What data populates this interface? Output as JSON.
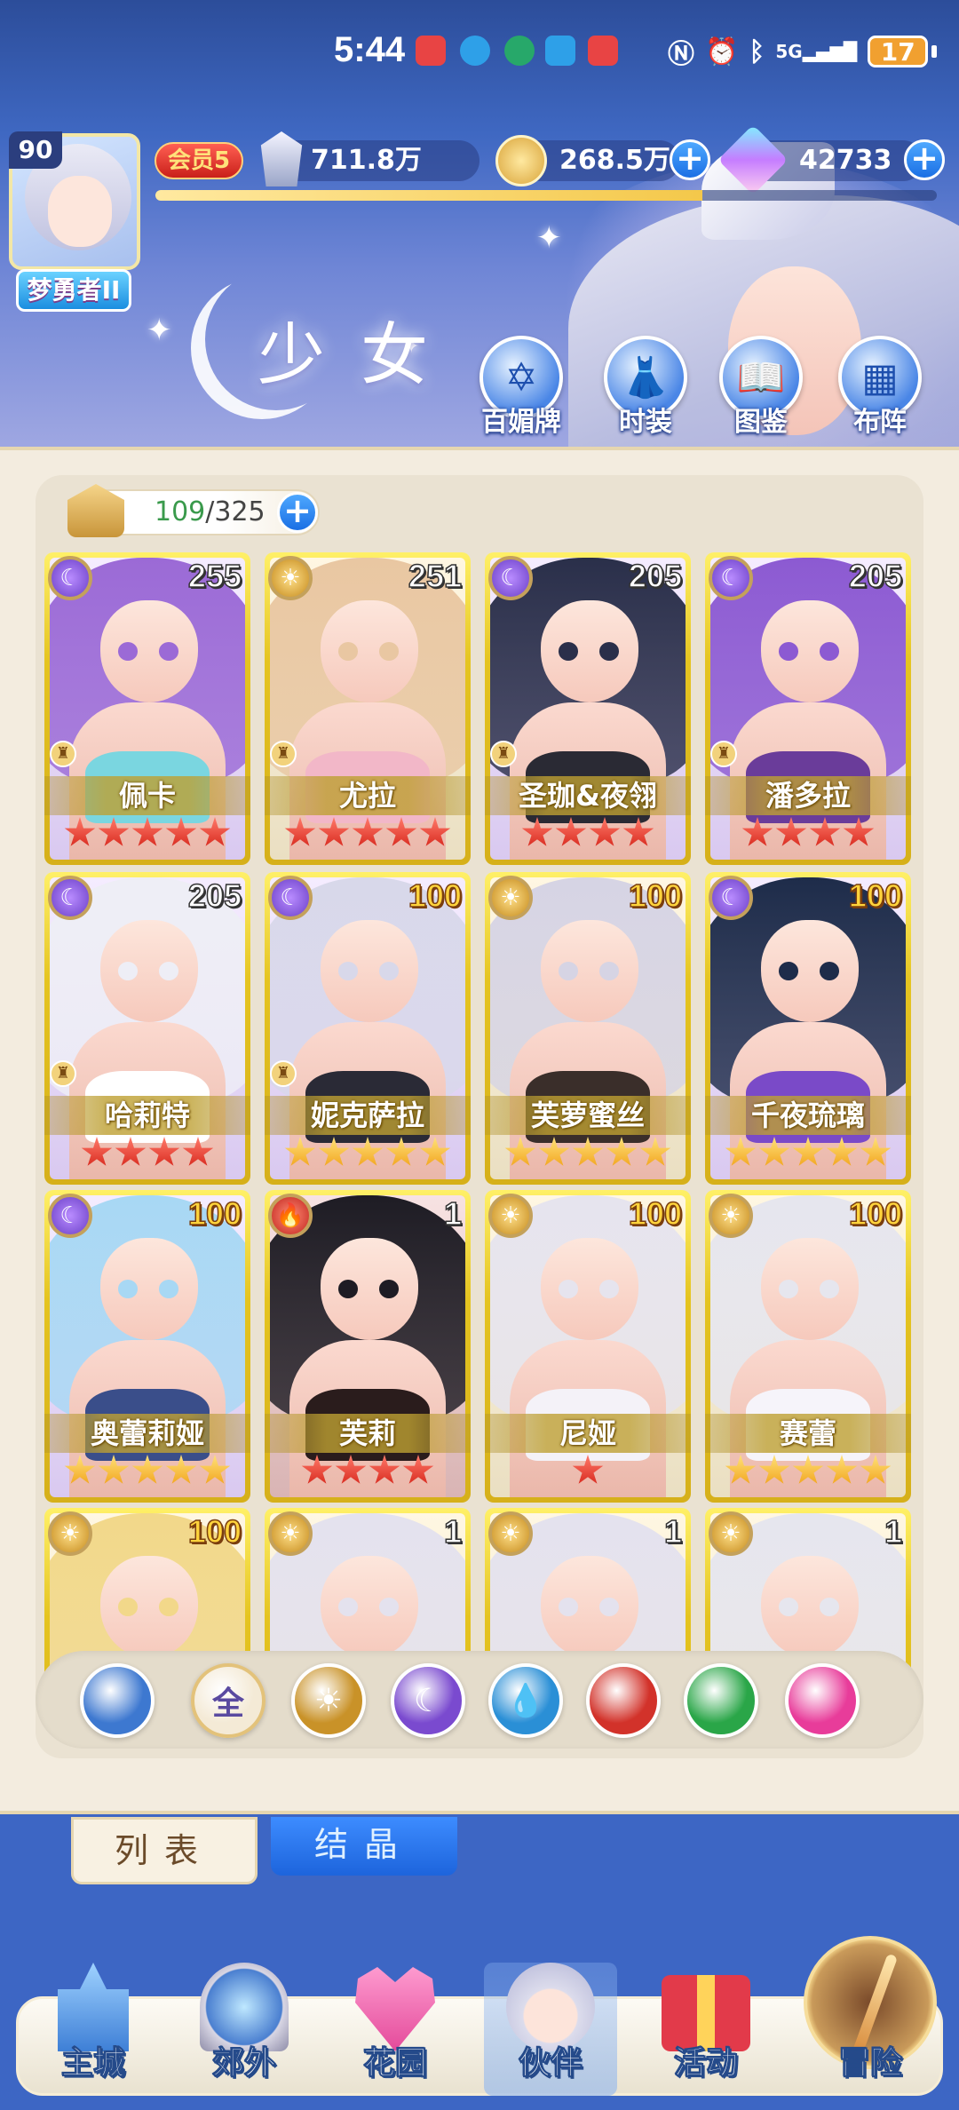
{
  "status_bar": {
    "time": "5:44",
    "network": "5G",
    "battery": "17"
  },
  "player": {
    "level": "90",
    "title": "梦勇者II",
    "vip": "会员5",
    "power": "711.8万",
    "coins": "268.5万",
    "gems": "42733",
    "xp_fraction": 0.7
  },
  "page": {
    "title": "少女",
    "buttons": [
      {
        "label": "百媚牌",
        "icon": "card-icon"
      },
      {
        "label": "时装",
        "icon": "outfit-icon"
      },
      {
        "label": "图鉴",
        "icon": "book-icon"
      },
      {
        "label": "布阵",
        "icon": "grid-icon"
      }
    ]
  },
  "collection": {
    "owned": "109",
    "total": "/325"
  },
  "cards": [
    {
      "name": "佩卡",
      "level": "255",
      "element": "moon",
      "stars": 5,
      "star_color": "red",
      "rank": true,
      "hair": "#9b6ad6",
      "outfit": "#7ad6e0"
    },
    {
      "name": "尤拉",
      "level": "251",
      "element": "sun",
      "stars": 5,
      "star_color": "red",
      "rank": true,
      "hair": "#e9c7a2",
      "outfit": "#f2b7c8"
    },
    {
      "name": "圣珈&夜翎",
      "level": "205",
      "element": "moon",
      "stars": 4,
      "star_color": "red",
      "rank": true,
      "hair": "#2a2f4a",
      "outfit": "#2a2a34"
    },
    {
      "name": "潘多拉",
      "level": "205",
      "element": "moon",
      "stars": 4,
      "star_color": "red",
      "rank": true,
      "hair": "#8c5ad2",
      "outfit": "#6a3c9a"
    },
    {
      "name": "哈莉特",
      "level": "205",
      "element": "moon",
      "stars": 4,
      "star_color": "red",
      "rank": true,
      "hair": "#eeeef6",
      "outfit": "#ffffff"
    },
    {
      "name": "妮克萨拉",
      "level": "100",
      "element": "moon",
      "stars": 5,
      "star_color": "gold",
      "rank": true,
      "hair": "#d8d8ea",
      "outfit": "#2a2a36"
    },
    {
      "name": "芙萝蜜丝",
      "level": "100",
      "element": "sun",
      "stars": 5,
      "star_color": "gold",
      "rank": false,
      "hair": "#d6d4e4",
      "outfit": "#3a2e2a"
    },
    {
      "name": "千夜琉璃",
      "level": "100",
      "element": "moon",
      "stars": 5,
      "star_color": "gold",
      "rank": false,
      "hair": "#1e2c4a",
      "outfit": "#7a4ac8"
    },
    {
      "name": "奥蕾莉娅",
      "level": "100",
      "element": "moon",
      "stars": 5,
      "star_color": "gold",
      "rank": false,
      "hair": "#a8d8f4",
      "outfit": "#3a4e8a"
    },
    {
      "name": "芙莉",
      "level": "1",
      "element": "fire",
      "stars": 4,
      "star_color": "red",
      "rank": false,
      "hair": "#1e1c24",
      "outfit": "#2a1c1c"
    },
    {
      "name": "尼娅",
      "level": "100",
      "element": "sun",
      "stars": 1,
      "star_color": "red",
      "rank": false,
      "hair": "#e6e4ee",
      "outfit": "#f4f2f8"
    },
    {
      "name": "赛蕾",
      "level": "100",
      "element": "sun",
      "stars": 5,
      "star_color": "gold",
      "rank": false,
      "hair": "#e6e6ee",
      "outfit": "#f6f4fa"
    },
    {
      "name": "",
      "level": "100",
      "element": "sun",
      "stars": 0,
      "star_color": "gold",
      "rank": false,
      "hair": "#f2d88a",
      "outfit": "#ffffff"
    },
    {
      "name": "",
      "level": "1",
      "element": "sun",
      "stars": 0,
      "star_color": "gold",
      "rank": false,
      "hair": "#e4e2ee",
      "outfit": "#b9a6d6"
    },
    {
      "name": "",
      "level": "1",
      "element": "sun",
      "stars": 0,
      "star_color": "gold",
      "rank": false,
      "hair": "#e4e2ee",
      "outfit": "#b9a6d6"
    },
    {
      "name": "",
      "level": "1",
      "element": "sun",
      "stars": 0,
      "star_color": "gold",
      "rank": false,
      "hair": "#e6e6ee",
      "outfit": "#1e1e28"
    }
  ],
  "filters": [
    {
      "name": "wing-filter",
      "label": "",
      "color": "#3d78d0"
    },
    {
      "name": "all-filter",
      "label": "全",
      "color": "#f4ead6"
    },
    {
      "name": "sun-filter",
      "label": "☀",
      "color": "#c99228"
    },
    {
      "name": "moon-filter",
      "label": "☾",
      "color": "#7a4acf"
    },
    {
      "name": "water-filter",
      "label": "💧",
      "color": "#2a8fd6"
    },
    {
      "name": "fire-filter",
      "label": "",
      "color": "#d2322a"
    },
    {
      "name": "wind-filter",
      "label": "",
      "color": "#2aa648"
    },
    {
      "name": "star-filter",
      "label": "",
      "color": "#e83c9a"
    }
  ],
  "tabs": {
    "list": "列表",
    "crystal": "结晶"
  },
  "nav": [
    {
      "label": "主城",
      "icon": "castle-icon"
    },
    {
      "label": "郊外",
      "icon": "portal-icon"
    },
    {
      "label": "花园",
      "icon": "heart-icon"
    },
    {
      "label": "伙伴",
      "icon": "partner-icon"
    },
    {
      "label": "活动",
      "icon": "gift-icon"
    },
    {
      "label": "冒险",
      "icon": "compass-icon"
    }
  ]
}
